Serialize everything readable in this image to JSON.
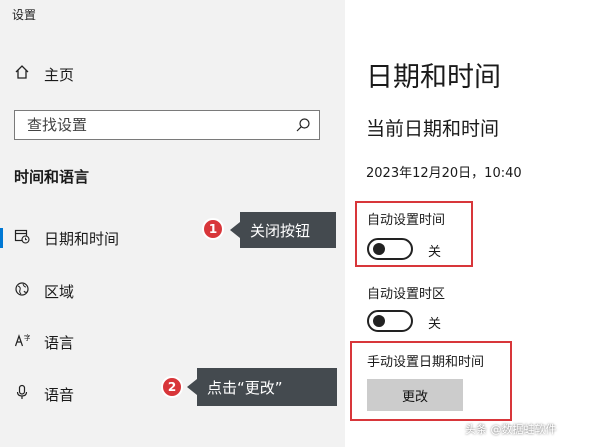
{
  "app_title": "设置",
  "sidebar": {
    "home_label": "主页",
    "search_placeholder": "查找设置",
    "section_title": "时间和语言",
    "items": [
      {
        "label": "日期和时间",
        "icon": "calendar-clock-icon"
      },
      {
        "label": "区域",
        "icon": "globe-icon"
      },
      {
        "label": "语言",
        "icon": "language-icon"
      },
      {
        "label": "语音",
        "icon": "microphone-icon"
      }
    ]
  },
  "main": {
    "title": "日期和时间",
    "subtitle": "当前日期和时间",
    "datetime": "2023年12月20日，10:40",
    "auto_time": {
      "label": "自动设置时间",
      "state": "关"
    },
    "auto_timezone": {
      "label": "自动设置时区",
      "state": "关"
    },
    "manual": {
      "label": "手动设置日期和时间",
      "button": "更改"
    }
  },
  "annotations": {
    "callout1": {
      "number": "1",
      "text": "关闭按钮"
    },
    "callout2": {
      "number": "2",
      "text": "点击“更改”"
    },
    "highlight_color": "#d8363a"
  },
  "watermark": "头条 @数据蛙软件"
}
